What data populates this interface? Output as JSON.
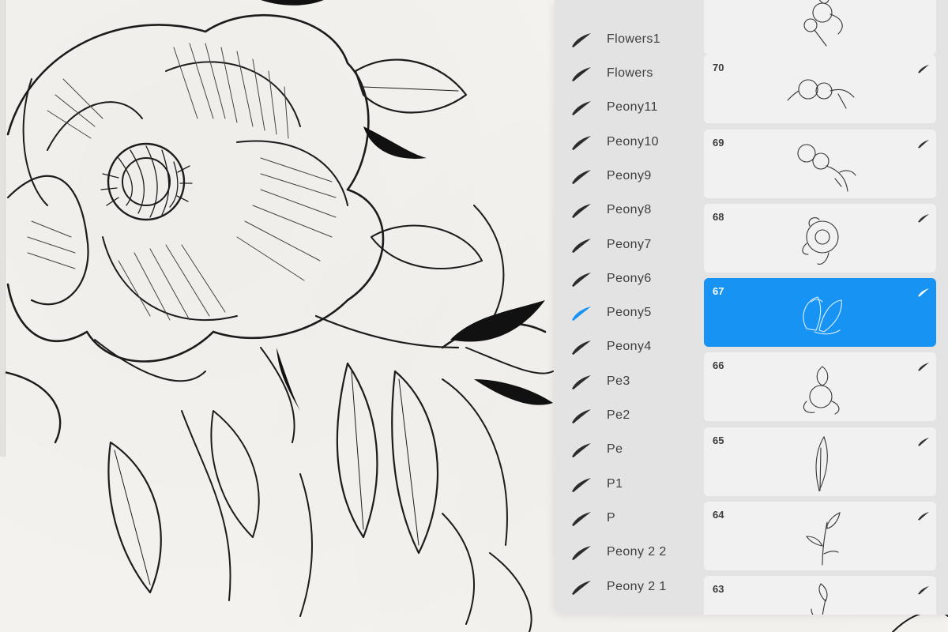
{
  "brush_sets": [
    {
      "label": "Flowers1",
      "selected": false
    },
    {
      "label": "Flowers",
      "selected": false
    },
    {
      "label": "Peony11",
      "selected": false
    },
    {
      "label": "Peony10",
      "selected": false
    },
    {
      "label": "Peony9",
      "selected": false
    },
    {
      "label": "Peony8",
      "selected": false
    },
    {
      "label": "Peony7",
      "selected": false
    },
    {
      "label": "Peony6",
      "selected": false
    },
    {
      "label": "Peony5",
      "selected": true
    },
    {
      "label": "Peony4",
      "selected": false
    },
    {
      "label": "Pe3",
      "selected": false
    },
    {
      "label": "Pe2",
      "selected": false
    },
    {
      "label": "Pe",
      "selected": false
    },
    {
      "label": "P1",
      "selected": false
    },
    {
      "label": "P",
      "selected": false
    },
    {
      "label": "Peony 2 2",
      "selected": false
    },
    {
      "label": "Peony 2 1",
      "selected": false
    }
  ],
  "brushes": [
    {
      "number": "",
      "thumbnail": "flower-cluster",
      "selected": false
    },
    {
      "number": "70",
      "thumbnail": "flower-branch",
      "selected": false
    },
    {
      "number": "69",
      "thumbnail": "flower-branch-long",
      "selected": false
    },
    {
      "number": "68",
      "thumbnail": "peony-bloom",
      "selected": false
    },
    {
      "number": "67",
      "thumbnail": "open-flower",
      "selected": true
    },
    {
      "number": "66",
      "thumbnail": "peony-bud",
      "selected": false
    },
    {
      "number": "65",
      "thumbnail": "single-leaf",
      "selected": false
    },
    {
      "number": "64",
      "thumbnail": "leaf-sprig",
      "selected": false
    },
    {
      "number": "63",
      "thumbnail": "leaf-stem",
      "selected": false
    }
  ],
  "colors": {
    "accent": "#1793f4",
    "panel_bg": "#e3e3e3",
    "card_bg": "#f1f1f1",
    "icon_dark": "#2b2b2b"
  }
}
